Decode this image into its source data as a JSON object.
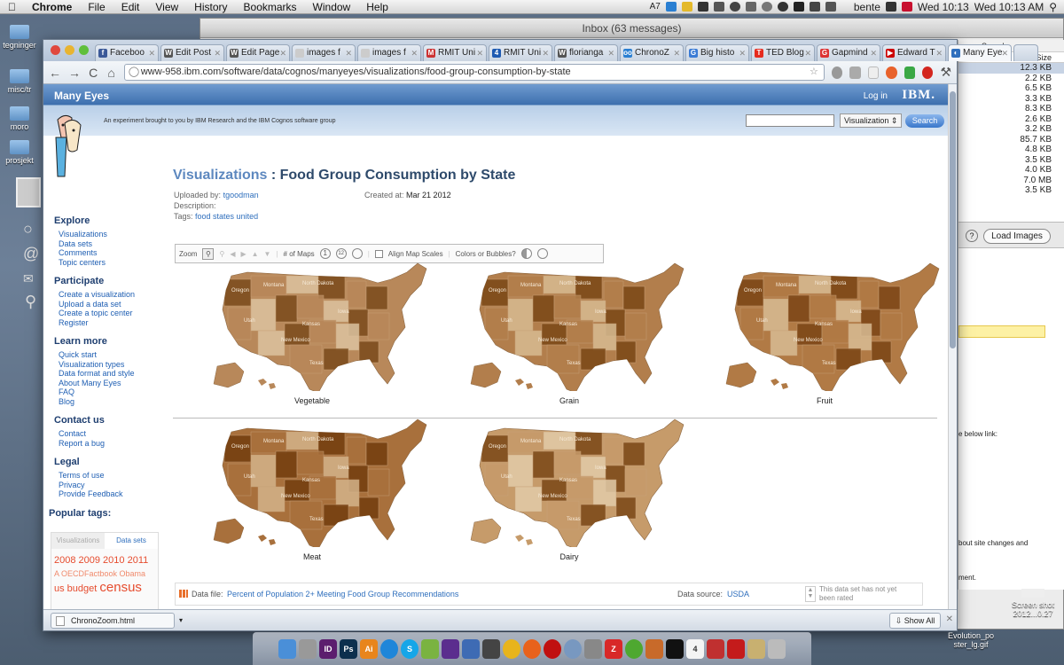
{
  "menubar": {
    "app": "Chrome",
    "items": [
      "File",
      "Edit",
      "View",
      "History",
      "Bookmarks",
      "Window",
      "Help"
    ],
    "status_count": "7",
    "user": "bente",
    "clock1": "Wed 10:13",
    "clock2": "Wed 10:13 AM"
  },
  "desktop": {
    "icons": [
      "tegninger",
      "misc/tr",
      "moro",
      "prosjekt"
    ]
  },
  "mail": {
    "title": "Inbox (63 messages)",
    "panel_header": "Search",
    "size_header": "Size",
    "sizes": [
      "12.3 KB",
      "2.2 KB",
      "6.5 KB",
      "3.3 KB",
      "8.3 KB",
      "2.6 KB",
      "3.2 KB",
      "85.7 KB",
      "4.8 KB",
      "3.5 KB",
      "4.0 KB",
      "7.0 MB",
      "3.5 KB"
    ],
    "load_images": "Load Images",
    "below_link": "e below link:",
    "site_changes": "bout site changes and",
    "ment": "ment."
  },
  "browser": {
    "tabs": [
      {
        "label": "Faceboo",
        "fav": "f",
        "color": "#3b5998"
      },
      {
        "label": "Edit Post",
        "fav": "W",
        "color": "#555"
      },
      {
        "label": "Edit Page",
        "fav": "W",
        "color": "#555"
      },
      {
        "label": "images f",
        "fav": "",
        "color": "#ccc"
      },
      {
        "label": "images f",
        "fav": "",
        "color": "#ccc"
      },
      {
        "label": "RMIT Uni",
        "fav": "M",
        "color": "#c33"
      },
      {
        "label": "RMIT Uni",
        "fav": "4",
        "color": "#1d5ab2"
      },
      {
        "label": "florianga",
        "fav": "W",
        "color": "#555"
      },
      {
        "label": "ChronoZ",
        "fav": "oo",
        "color": "#2a7fd2"
      },
      {
        "label": "Big histo",
        "fav": "G",
        "color": "#3a7bd5"
      },
      {
        "label": "TED Blog",
        "fav": "T",
        "color": "#e62b1e"
      },
      {
        "label": "Gapmind",
        "fav": "G",
        "color": "#d33"
      },
      {
        "label": "Edward T",
        "fav": "▶",
        "color": "#c00"
      },
      {
        "label": "Many Eye",
        "fav": "◐",
        "color": "#2f6fbd",
        "active": true
      }
    ],
    "url": "www-958.ibm.com/software/data/cognos/manyeyes/visualizations/food-group-consumption-by-state"
  },
  "site": {
    "brand": "Many Eyes",
    "login": "Log in",
    "ibm": "IBM.",
    "subtitle": "An experiment brought to you by IBM Research and the IBM Cognos software group",
    "search_select": "Visualization",
    "search_button": "Search"
  },
  "sidebar": {
    "explore": "Explore",
    "explore_links": [
      "Visualizations",
      "Data sets",
      "Comments",
      "Topic centers"
    ],
    "participate": "Participate",
    "participate_links": [
      "Create a visualization",
      "Upload a data set",
      "Create a topic center",
      "Register"
    ],
    "learn": "Learn more",
    "learn_links": [
      "Quick start",
      "Visualization types",
      "Data format and style",
      "About Many Eyes",
      "FAQ",
      "Blog"
    ],
    "contact": "Contact us",
    "contact_links": [
      "Contact",
      "Report a bug"
    ],
    "legal": "Legal",
    "legal_links": [
      "Terms of use",
      "Privacy",
      "Provide Feedback"
    ],
    "popular": "Popular tags:",
    "tag_tabs": [
      "Visualizations",
      "Data sets"
    ],
    "tags_line1": "2008 2009 2010 2011",
    "tags_line2": "A  OECDFactbook  Obama",
    "tags_line3a": "us budget",
    "tags_line3b": "census"
  },
  "main": {
    "crumb": "Visualizations",
    "sep": " : ",
    "title": "Food Group Consumption by State",
    "uploaded_label": "Uploaded by:",
    "uploaded_by": "tgoodman",
    "created_label": "Created at:",
    "created_at": "Mar 21 2012",
    "description_label": "Description:",
    "tags_label": "Tags:",
    "tags": "food states united",
    "toolbar": {
      "zoom": "Zoom",
      "num_maps": "# of Maps",
      "align": "Align Map Scales",
      "colors": "Colors or Bubbles?"
    },
    "maps": [
      {
        "label": "Vegetable",
        "fill": "#b8885a",
        "dark": "#7a4a1c",
        "light": "#dcc4a0"
      },
      {
        "label": "Grain",
        "fill": "#b27e4c",
        "dark": "#7a4716",
        "light": "#d8bb92"
      },
      {
        "label": "Fruit",
        "fill": "#b17a45",
        "dark": "#7b4515",
        "light": "#d9bd95"
      },
      {
        "label": "Meat",
        "fill": "#a8703c",
        "dark": "#733d0e",
        "light": "#d4b38a"
      },
      {
        "label": "Dairy",
        "fill": "#c69b6a",
        "dark": "#7a4716",
        "light": "#e2cca8"
      }
    ],
    "state_labels": [
      "Oregon",
      "Montana",
      "North Dakota",
      "Iowa",
      "Utah",
      "Kansas",
      "New Mexico",
      "Texas"
    ],
    "data_file_label": "Data file:",
    "data_file": "Percent of Population 2+ Meeting Food Group Recommendations",
    "data_source_label": "Data source:",
    "data_source": "USDA",
    "rating": "This data set has not yet been rated"
  },
  "downloads": {
    "file": "ChronoZoom.html",
    "show_all": "Show All"
  },
  "desktop_files": {
    "screenshot": "Screen shot 2012...0.27",
    "gif": "Evolution_po ster_lg.gif"
  }
}
